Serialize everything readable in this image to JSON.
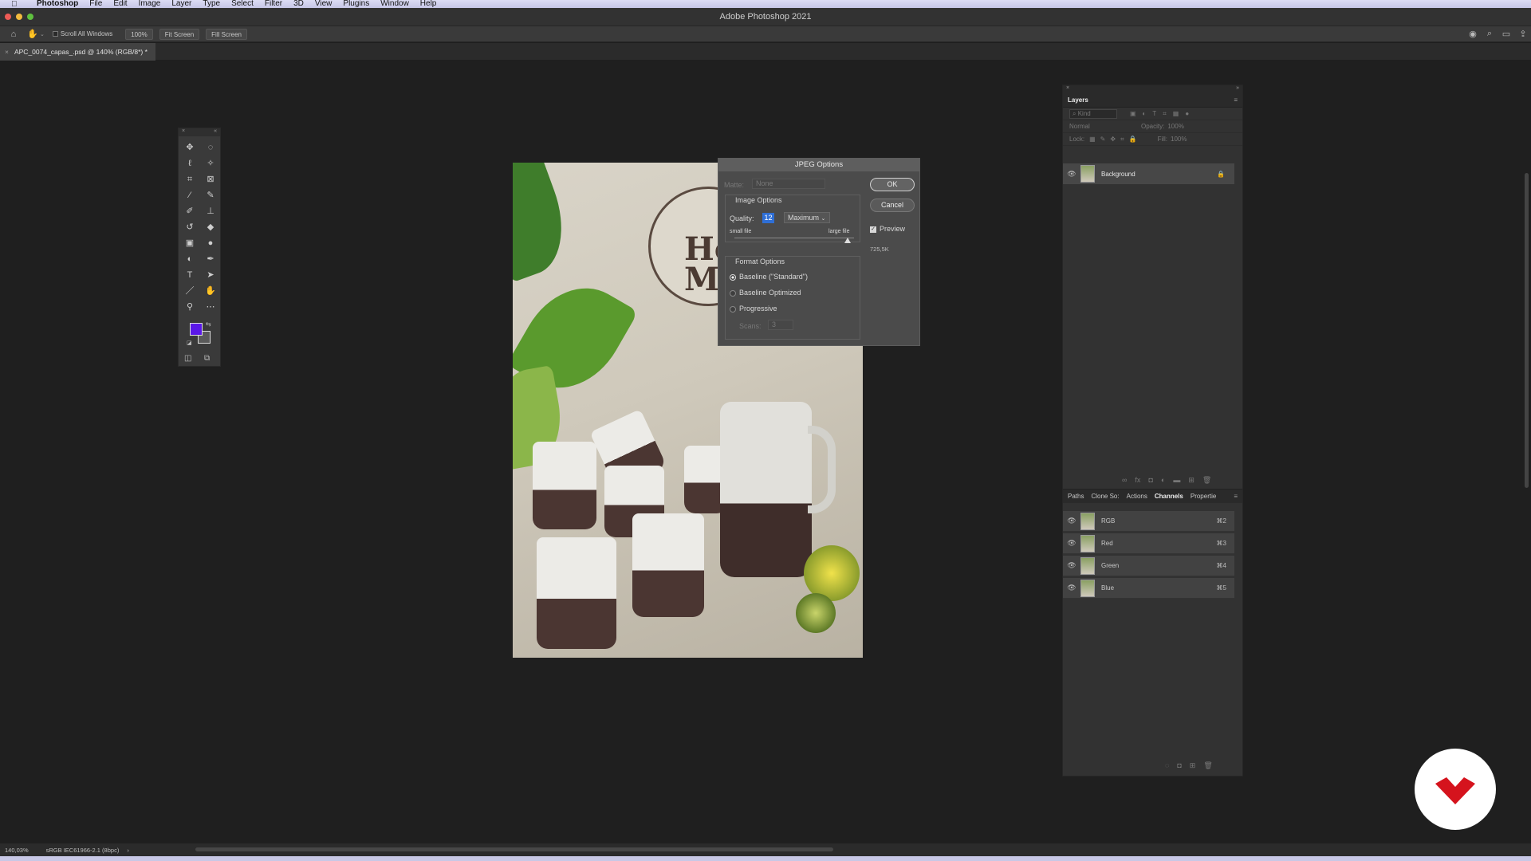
{
  "menubar": {
    "apple_icon": "apple-icon",
    "app_name": "Photoshop",
    "items": [
      "File",
      "Edit",
      "Image",
      "Layer",
      "Type",
      "Select",
      "Filter",
      "3D",
      "View",
      "Plugins",
      "Window",
      "Help"
    ]
  },
  "window": {
    "title": "Adobe Photoshop 2021"
  },
  "options_bar": {
    "scroll_all_windows": "Scroll All Windows",
    "zoom_100": "100%",
    "fit_screen": "Fit Screen",
    "fill_screen": "Fill Screen"
  },
  "document": {
    "tab_title": "APC_0074_capas_.psd @ 140% (RGB/8*) *",
    "logo_text_line1": "Ho",
    "logo_text_line2": "Ma"
  },
  "jpeg_dialog": {
    "title": "JPEG Options",
    "matte_label": "Matte:",
    "matte_value": "None",
    "image_options_label": "Image Options",
    "quality_label": "Quality:",
    "quality_value": "12",
    "quality_preset": "Maximum",
    "small_file": "small file",
    "large_file": "large file",
    "format_options_label": "Format Options",
    "format_baseline": "Baseline (\"Standard\")",
    "format_baseline_optimized": "Baseline Optimized",
    "format_progressive": "Progressive",
    "scans_label": "Scans:",
    "scans_value": "3",
    "ok_label": "OK",
    "cancel_label": "Cancel",
    "preview_label": "Preview",
    "file_size": "725,5K"
  },
  "layers_panel": {
    "title": "Layers",
    "kind_placeholder": "Kind",
    "blend_mode": "Normal",
    "opacity_label": "Opacity:",
    "opacity_value": "100%",
    "lock_label": "Lock:",
    "fill_label": "Fill:",
    "fill_value": "100%",
    "layers": [
      {
        "name": "Background"
      }
    ]
  },
  "channels_panel": {
    "tabs": [
      "Paths",
      "Clone So:",
      "Actions",
      "Channels",
      "Propertie"
    ],
    "active_tab": "Channels",
    "channels": [
      {
        "name": "RGB",
        "shortcut": "⌘2"
      },
      {
        "name": "Red",
        "shortcut": "⌘3"
      },
      {
        "name": "Green",
        "shortcut": "⌘4"
      },
      {
        "name": "Blue",
        "shortcut": "⌘5"
      }
    ]
  },
  "status_bar": {
    "zoom": "140,03%",
    "profile": "sRGB IEC61966-2.1 (8bpc)",
    "arrow": "›"
  },
  "colors": {
    "foreground": "#5a17e8",
    "background": "#5a5a5a",
    "accent_blue": "#2f6fd6"
  }
}
